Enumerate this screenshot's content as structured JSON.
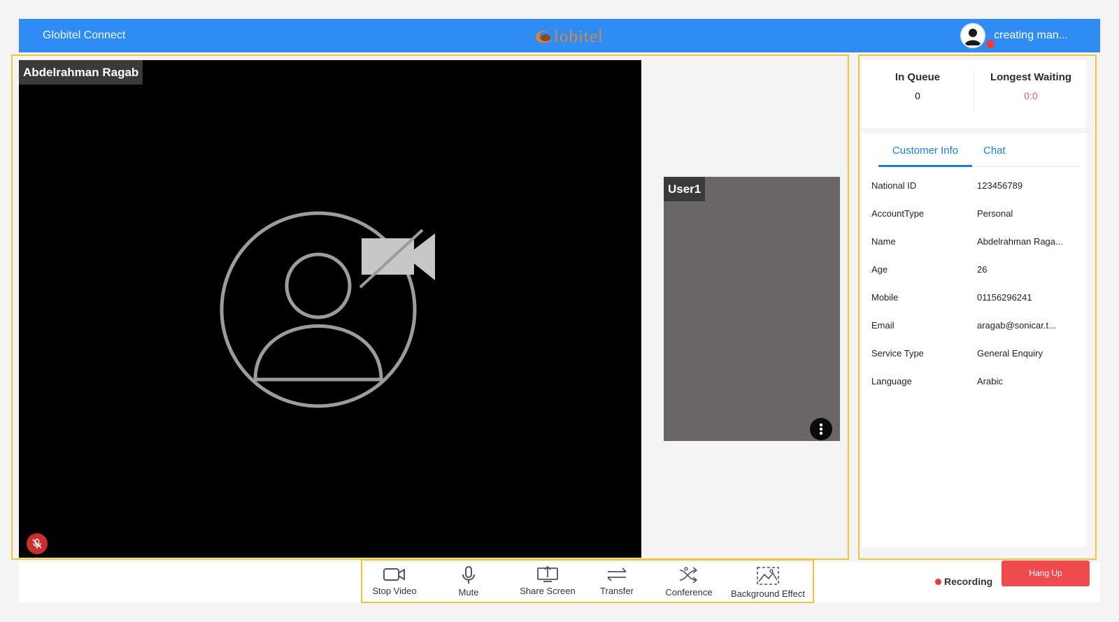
{
  "header": {
    "app_title": "Globitel Connect",
    "logo_text": "lobitel",
    "user_name": "creating man...",
    "user_status_color": "#ef3b3b"
  },
  "main_video": {
    "participant_name": "Abdelrahman Ragab",
    "placeholder_icon": "video-off-user-icon",
    "mic_state_icon": "mic-off-icon"
  },
  "side_video": {
    "participant_name": "User1",
    "menu_icon": "more-vertical-icon"
  },
  "queue": {
    "in_queue_label": "In Queue",
    "in_queue_value": "0",
    "longest_waiting_label": "Longest Waiting",
    "longest_waiting_value": "0:0",
    "longest_waiting_color": "#e06060"
  },
  "tabs": [
    {
      "label": "Customer Info",
      "active": true
    },
    {
      "label": "Chat",
      "active": false
    }
  ],
  "customer_info": [
    {
      "label": "National ID",
      "value": "123456789"
    },
    {
      "label": "AccountType",
      "value": "Personal"
    },
    {
      "label": "Name",
      "value": "Abdelrahman Raga..."
    },
    {
      "label": "Age",
      "value": "26"
    },
    {
      "label": "Mobile",
      "value": "01156296241"
    },
    {
      "label": "Email",
      "value": "aragab@sonicar.t..."
    },
    {
      "label": "Service Type",
      "value": "General Enquiry"
    },
    {
      "label": "Language",
      "value": "Arabic"
    }
  ],
  "toolbar": {
    "stop_video": "Stop Video",
    "mute": "Mute",
    "share_screen": "Share Screen",
    "transfer": "Transfer",
    "conference": "Conference",
    "background_effect": "Background Effect"
  },
  "call": {
    "recording_label": "Recording",
    "hangup_label": "Hang Up"
  },
  "colors": {
    "header_blue": "#2f8cf5",
    "accent_blue": "#1a7ee0",
    "frame_yellow": "#f4c438",
    "hangup_red": "#ef4b4f"
  }
}
